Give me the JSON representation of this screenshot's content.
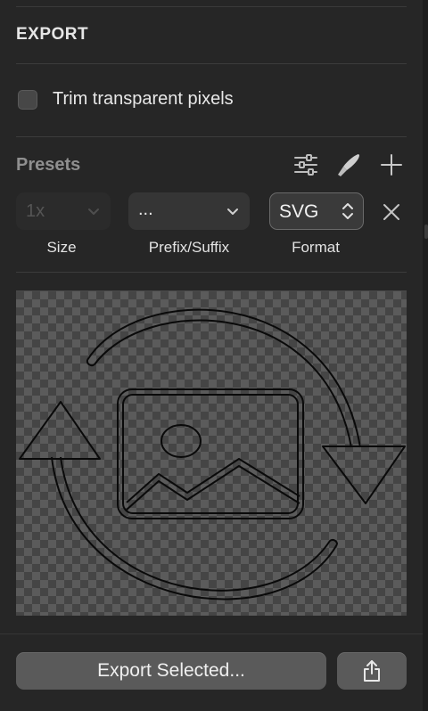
{
  "section": {
    "title": "EXPORT"
  },
  "trim": {
    "label": "Trim transparent pixels",
    "checked": false
  },
  "presets": {
    "title": "Presets",
    "icons": [
      "sliders-icon",
      "knife-icon",
      "plus-icon"
    ]
  },
  "row": {
    "size": {
      "value": "1x",
      "label": "Size"
    },
    "prefix": {
      "value": "...",
      "label": "Prefix/Suffix"
    },
    "format": {
      "value": "SVG",
      "label": "Format"
    }
  },
  "preview": {
    "icon": "image-sync-icon"
  },
  "footer": {
    "export_label": "Export Selected...",
    "share_icon": "share-icon"
  }
}
